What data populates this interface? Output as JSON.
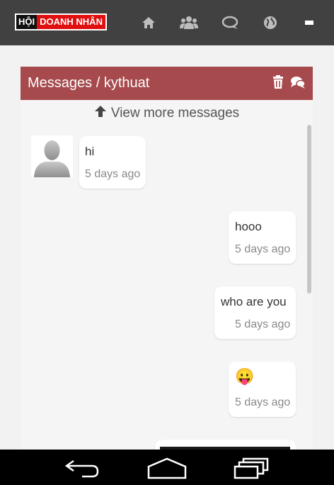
{
  "app": {
    "logo_part1": "HỘI",
    "logo_part2": "DOANH NHÂN"
  },
  "nav_icons": [
    "home-icon",
    "users-icon",
    "chat-icon",
    "globe-icon",
    "menu-icon"
  ],
  "panel": {
    "title": "Messages / kythuat",
    "view_more": "View more messages"
  },
  "messages": [
    {
      "side": "left",
      "text": "hi",
      "time": "5 days ago"
    },
    {
      "side": "right",
      "text": "hooo",
      "time": "5 days ago"
    },
    {
      "side": "right",
      "text": "who are you",
      "time": "5 days ago"
    },
    {
      "side": "right",
      "text": "😛",
      "time": "5 days ago"
    }
  ],
  "colors": {
    "topbar": "#414141",
    "panel_header": "#a64a4d",
    "logo_red": "#e01010"
  }
}
